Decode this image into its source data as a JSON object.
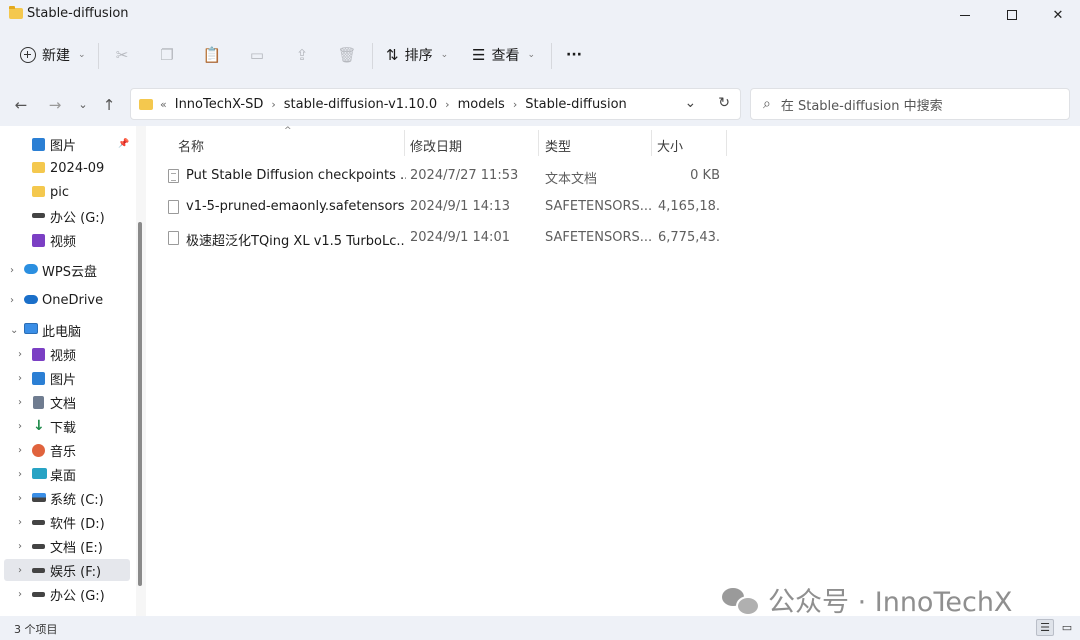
{
  "window": {
    "title": "Stable-diffusion",
    "minimize_glyph": "—",
    "maximize_glyph": "□",
    "close_glyph": "✕"
  },
  "toolbar": {
    "new_label": "新建",
    "sort_label": "排序",
    "view_label": "查看",
    "more_glyph": "···",
    "caret": "⌄"
  },
  "nav": {
    "back_glyph": "←",
    "forward_glyph": "→",
    "recent_glyph": "⌄",
    "up_glyph": "↑"
  },
  "address": {
    "overflow": "«",
    "crumbs": [
      "InnoTechX-SD",
      "stable-diffusion-v1.10.0",
      "models",
      "Stable-diffusion"
    ],
    "separator": "›",
    "dropdown_glyph": "⌄",
    "refresh_glyph": "↻"
  },
  "search": {
    "placeholder": "在 Stable-diffusion 中搜索",
    "icon": "search-icon"
  },
  "sidebar": {
    "items": [
      {
        "label": "图片",
        "icon": "pictures-icon",
        "pinned": true
      },
      {
        "label": "2024-09",
        "icon": "folder-icon"
      },
      {
        "label": "pic",
        "icon": "folder-icon"
      },
      {
        "label": "办公 (G:)",
        "icon": "drive-icon"
      },
      {
        "label": "视频",
        "icon": "videos-icon"
      },
      {
        "label": "WPS云盘",
        "icon": "cloud-icon"
      },
      {
        "label": "OneDrive",
        "icon": "onedrive-icon"
      },
      {
        "label": "此电脑",
        "icon": "pc-icon"
      },
      {
        "label": "视频",
        "icon": "videos-icon"
      },
      {
        "label": "图片",
        "icon": "pictures-icon"
      },
      {
        "label": "文档",
        "icon": "documents-icon"
      },
      {
        "label": "下载",
        "icon": "download-icon"
      },
      {
        "label": "音乐",
        "icon": "music-icon"
      },
      {
        "label": "桌面",
        "icon": "desktop-icon"
      },
      {
        "label": "系统 (C:)",
        "icon": "windows-drive-icon"
      },
      {
        "label": "软件 (D:)",
        "icon": "drive-icon"
      },
      {
        "label": "文档 (E:)",
        "icon": "drive-icon"
      },
      {
        "label": "娱乐 (F:)",
        "icon": "drive-icon",
        "selected": true
      },
      {
        "label": "办公 (G:)",
        "icon": "drive-icon"
      }
    ],
    "chevron_right": "›",
    "chevron_down": "⌄",
    "pin_glyph": "📌"
  },
  "columns": {
    "name": "名称",
    "modified": "修改日期",
    "type": "类型",
    "size": "大小",
    "sort_glyph": "^"
  },
  "files": [
    {
      "name": "Put Stable Diffusion checkpoints ...",
      "modified": "2024/7/27 11:53",
      "type": "文本文档",
      "size": "0 KB"
    },
    {
      "name": "v1-5-pruned-emaonly.safetensors",
      "modified": "2024/9/1 14:13",
      "type": "SAFETENSORS...",
      "size": "4,165,18..."
    },
    {
      "name": "极速超泛化TQing XL v1.5 TurboLc...",
      "modified": "2024/9/1 14:01",
      "type": "SAFETENSORS...",
      "size": "6,775,43..."
    }
  ],
  "status": {
    "count": "3 个项目"
  },
  "watermark": {
    "text": "公众号 · InnoTechX"
  },
  "colors": {
    "folder": "#f4c84e",
    "accent": "#0067c0",
    "chrome": "#eef1f7"
  }
}
